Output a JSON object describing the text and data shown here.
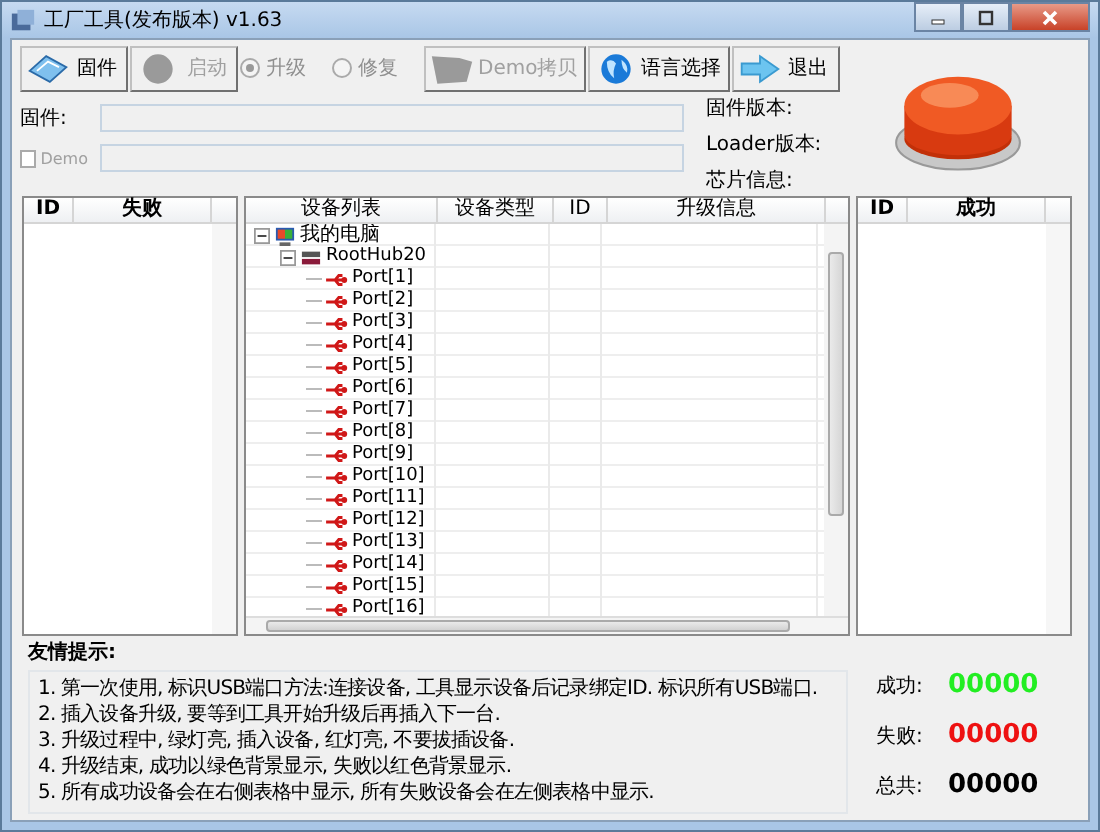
{
  "window": {
    "title": "工厂工具(发布版本) v1.63"
  },
  "toolbar": [
    {
      "kind": "button",
      "label": "固件",
      "disabled": false
    },
    {
      "kind": "button",
      "label": "启动",
      "disabled": true
    },
    {
      "kind": "radio",
      "label": "升级",
      "selected": true,
      "disabled": true
    },
    {
      "kind": "radio",
      "label": "修复",
      "selected": false,
      "disabled": true
    },
    {
      "kind": "button",
      "label": "Demo拷贝",
      "disabled": true
    },
    {
      "kind": "button",
      "label": "语言选择",
      "disabled": false
    },
    {
      "kind": "button",
      "label": "退出",
      "disabled": false
    }
  ],
  "firmware_field": {
    "label": "固件:"
  },
  "demo_checkbox": {
    "label": "Demo",
    "checked": false,
    "disabled": true
  },
  "info_labels": [
    "固件版本:",
    "Loader版本:",
    "芯片信息:"
  ],
  "failed_table": {
    "columns": [
      "ID",
      "失败"
    ]
  },
  "device_table": {
    "columns": [
      "设备列表",
      "设备类型",
      "ID",
      "升级信息"
    ],
    "tree": [
      {
        "label": "我的电脑",
        "expanded": true,
        "children": [
          {
            "label": "RootHub20",
            "expanded": true,
            "children": [
              {
                "label": "Port[1]"
              },
              {
                "label": "Port[2]"
              },
              {
                "label": "Port[3]"
              },
              {
                "label": "Port[4]"
              },
              {
                "label": "Port[5]"
              },
              {
                "label": "Port[6]"
              },
              {
                "label": "Port[7]"
              },
              {
                "label": "Port[8]"
              },
              {
                "label": "Port[9]"
              },
              {
                "label": "Port[10]"
              },
              {
                "label": "Port[11]"
              },
              {
                "label": "Port[12]"
              },
              {
                "label": "Port[13]"
              },
              {
                "label": "Port[14]"
              },
              {
                "label": "Port[15]"
              },
              {
                "label": "Port[16]"
              }
            ]
          }
        ]
      }
    ]
  },
  "success_table": {
    "columns": [
      "ID",
      "成功"
    ]
  },
  "tips": {
    "title": "友情提示:",
    "lines": [
      "1. 第一次使用, 标识USB端口方法:连接设备, 工具显示设备后记录绑定ID. 标识所有USB端口.",
      "2. 插入设备升级, 要等到工具开始升级后再插入下一台.",
      "3. 升级过程中, 绿灯亮, 插入设备, 红灯亮, 不要拔插设备.",
      "4. 升级结束, 成功以绿色背景显示, 失败以红色背景显示.",
      "5. 所有成功设备会在右侧表格中显示, 所有失败设备会在左侧表格中显示."
    ]
  },
  "stats": [
    {
      "label": "成功:",
      "value": "00000",
      "color": "#22ee22"
    },
    {
      "label": "失败:",
      "value": "00000",
      "color": "#ee1111"
    },
    {
      "label": "总共:",
      "value": "00000",
      "color": "#000000"
    }
  ]
}
